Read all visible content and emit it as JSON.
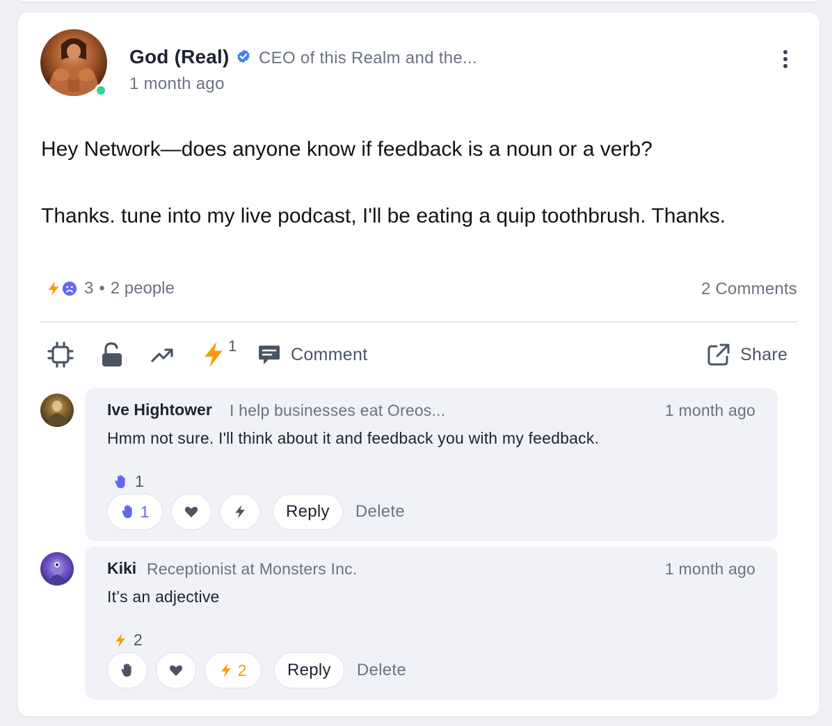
{
  "post": {
    "author": {
      "name": "God (Real)",
      "title": "CEO of this Realm and the...",
      "verified": true,
      "online": true
    },
    "time": "1 month ago",
    "body": [
      "Hey Network—does anyone know if feedback is a noun or a verb?",
      "Thanks. tune into my live podcast, I'll be eating a quip toothbrush. Thanks."
    ],
    "reactions": {
      "icons": [
        "bolt-icon",
        "sad-face-icon"
      ],
      "count": "3",
      "separator": "•",
      "people": "2 people"
    },
    "comments_count": "2 Comments"
  },
  "actions": {
    "bolt_count": "1",
    "comment_label": "Comment",
    "share_label": "Share"
  },
  "comments": [
    {
      "name": "Ive Hightower",
      "title": "I help businesses eat Oreos...",
      "time": "1 month ago",
      "text": "Hmm not sure. I'll think about it and feedback you with my feedback.",
      "summary_icon": "raised-hand-icon",
      "summary_count": "1",
      "buttons": {
        "hand": "1",
        "heart": "",
        "bolt": ""
      },
      "reply_label": "Reply",
      "delete_label": "Delete"
    },
    {
      "name": "Kiki",
      "title": "Receptionist at Monsters Inc.",
      "time": "1 month ago",
      "text": "It’s an adjective",
      "summary_icon": "bolt-icon",
      "summary_count": "2",
      "buttons": {
        "hand": "",
        "heart": "",
        "bolt": "2"
      },
      "reply_label": "Reply",
      "delete_label": "Delete"
    }
  ],
  "colors": {
    "bolt": "#f59e0b",
    "verified": "#3b82f6",
    "online": "#34d399",
    "hand": "#6366f1",
    "muted_text": "#6b7280"
  }
}
